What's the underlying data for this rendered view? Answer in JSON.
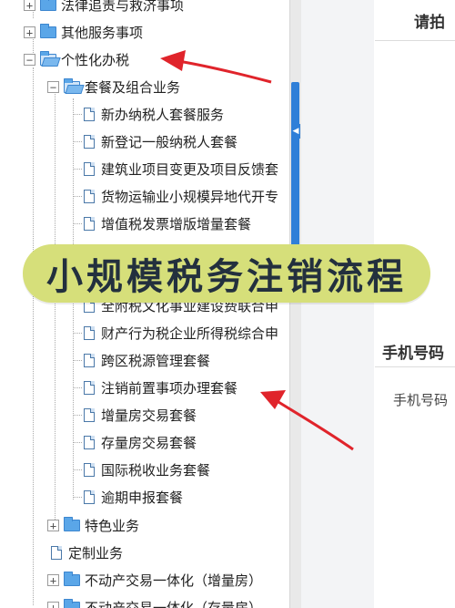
{
  "tree": {
    "items": [
      {
        "label": "法律追责与救济事项",
        "toggle": "+",
        "icon": "folder-icon"
      },
      {
        "label": "其他服务事项",
        "toggle": "+",
        "icon": "folder-icon"
      },
      {
        "label": "个性化办税",
        "toggle": "−",
        "icon": "folder-open-icon"
      },
      {
        "label": "套餐及组合业务",
        "toggle": "−",
        "icon": "folder-open-icon"
      },
      {
        "label": "新办纳税人套餐服务",
        "icon": "page-icon"
      },
      {
        "label": "新登记一般纳税人套餐",
        "icon": "page-icon"
      },
      {
        "label": "建筑业项目变更及项目反馈套",
        "icon": "page-icon"
      },
      {
        "label": "货物运输业小规模异地代开专",
        "icon": "page-icon"
      },
      {
        "label": "增值税发票增版增量套餐",
        "icon": "page-icon"
      },
      {
        "label": "全附税文化事业建设费联合申",
        "icon": "page-icon"
      },
      {
        "label": "财产行为税企业所得税综合申",
        "icon": "page-icon"
      },
      {
        "label": "跨区税源管理套餐",
        "icon": "page-icon"
      },
      {
        "label": "注销前置事项办理套餐",
        "icon": "page-icon"
      },
      {
        "label": "增量房交易套餐",
        "icon": "page-icon"
      },
      {
        "label": "存量房交易套餐",
        "icon": "page-icon"
      },
      {
        "label": "国际税收业务套餐",
        "icon": "page-icon"
      },
      {
        "label": "逾期申报套餐",
        "icon": "page-icon"
      },
      {
        "label": "特色业务",
        "toggle": "+",
        "icon": "folder-icon"
      },
      {
        "label": "定制业务",
        "icon": "page-icon"
      },
      {
        "label": "不动产交易一体化（增量房）",
        "toggle": "+",
        "icon": "folder-icon"
      },
      {
        "label": "不动产交易一体化（存量房）",
        "toggle": "+",
        "icon": "folder-icon"
      }
    ]
  },
  "right_panel": {
    "header": "请拍",
    "phone_section_title": "手机号码",
    "phone_field_label": "手机号码"
  },
  "banner": {
    "text": "小规模税务注销流程"
  },
  "colors": {
    "accent": "#2f7fd8",
    "banner_bg": "#d6df7a",
    "arrow": "#e0242b"
  }
}
